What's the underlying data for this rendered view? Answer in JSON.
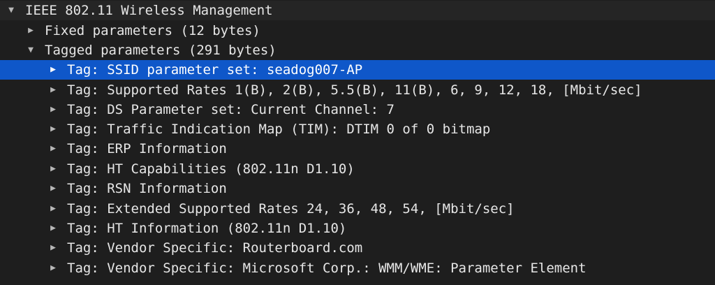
{
  "tree": {
    "root": {
      "label": "IEEE 802.11 Wireless Management",
      "expander": "▼",
      "expander_icon": "triangle-down-icon"
    },
    "fixed": {
      "label": "Fixed parameters (12 bytes)",
      "expander": "▶",
      "expander_icon": "triangle-right-icon"
    },
    "tagged": {
      "label": "Tagged parameters (291 bytes)",
      "expander": "▼",
      "expander_icon": "triangle-down-icon"
    },
    "tags": [
      {
        "label": "Tag: SSID parameter set: seadog007-AP",
        "expander": "▶"
      },
      {
        "label": "Tag: Supported Rates 1(B), 2(B), 5.5(B), 11(B), 6, 9, 12, 18, [Mbit/sec]",
        "expander": "▶"
      },
      {
        "label": "Tag: DS Parameter set: Current Channel: 7",
        "expander": "▶"
      },
      {
        "label": "Tag: Traffic Indication Map (TIM): DTIM 0 of 0 bitmap",
        "expander": "▶"
      },
      {
        "label": "Tag: ERP Information",
        "expander": "▶"
      },
      {
        "label": "Tag: HT Capabilities (802.11n D1.10)",
        "expander": "▶"
      },
      {
        "label": "Tag: RSN Information",
        "expander": "▶"
      },
      {
        "label": "Tag: Extended Supported Rates 24, 36, 48, 54, [Mbit/sec]",
        "expander": "▶"
      },
      {
        "label": "Tag: HT Information (802.11n D1.10)",
        "expander": "▶"
      },
      {
        "label": "Tag: Vendor Specific: Routerboard.com",
        "expander": "▶"
      },
      {
        "label": "Tag: Vendor Specific: Microsoft Corp.: WMM/WME: Parameter Element",
        "expander": "▶"
      }
    ]
  },
  "colors": {
    "background": "#1e1e1e",
    "text": "#e6e6e6",
    "selection": "#0f57c9"
  }
}
